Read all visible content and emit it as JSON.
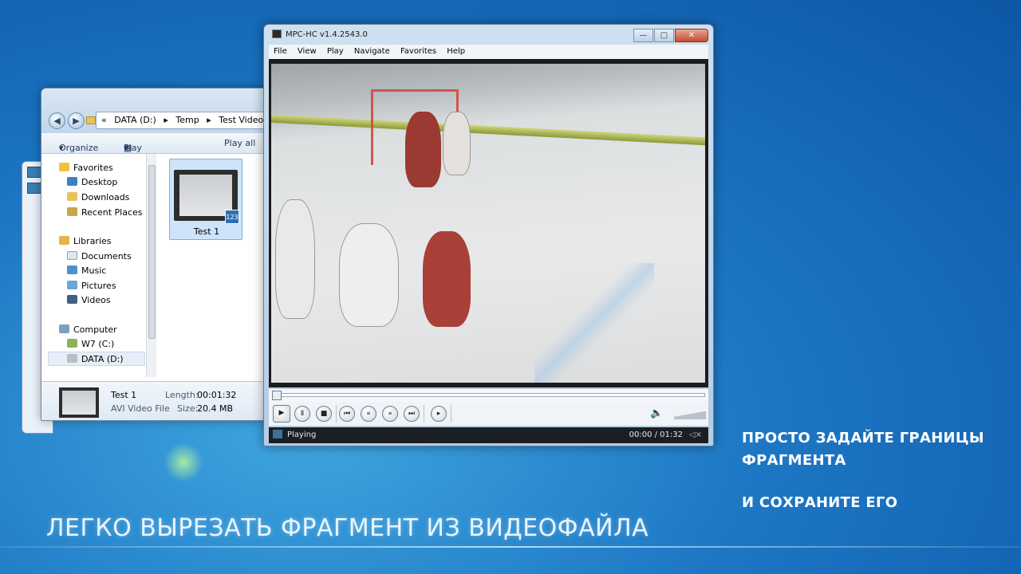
{
  "explorer": {
    "address": [
      "DATA (D:)",
      "Temp",
      "Test Video"
    ],
    "toolbar": {
      "organize": "Organize",
      "play_with": "Play with MPC",
      "play_all": "Play all"
    },
    "nav": {
      "favorites": "Favorites",
      "fav_items": [
        "Desktop",
        "Downloads",
        "Recent Places"
      ],
      "libraries": "Libraries",
      "lib_items": [
        "Documents",
        "Music",
        "Pictures",
        "Videos"
      ],
      "computer": "Computer",
      "drives": [
        "W7 (C:)",
        "DATA (D:)"
      ]
    },
    "file": {
      "name": "Test 1",
      "badge": "123"
    },
    "details": {
      "name": "Test 1",
      "type": "AVI Video File",
      "length_label": "Length:",
      "length": "00:01:32",
      "size_label": "Size:",
      "size": "20.4 MB"
    }
  },
  "mpc": {
    "title": "MPC-HC v1.4.2543.0",
    "menu": [
      "File",
      "View",
      "Play",
      "Navigate",
      "Favorites",
      "Help"
    ],
    "status": "Playing",
    "time": "00:00 / 01:32"
  },
  "captions": {
    "main": "ЛЕГКО ВЫРЕЗАТЬ ФРАГМЕНТ ИЗ ВИДЕОФАЙЛА",
    "right_line1": "ПРОСТО ЗАДАЙТЕ ГРАНИЦЫ",
    "right_line2": "ФРАГМЕНТА",
    "right_line3": "И СОХРАНИТЕ ЕГО"
  },
  "colors": {
    "desktop": "#1d77c4",
    "caption": "#ffffff",
    "status_bar": "#1b1f24"
  }
}
